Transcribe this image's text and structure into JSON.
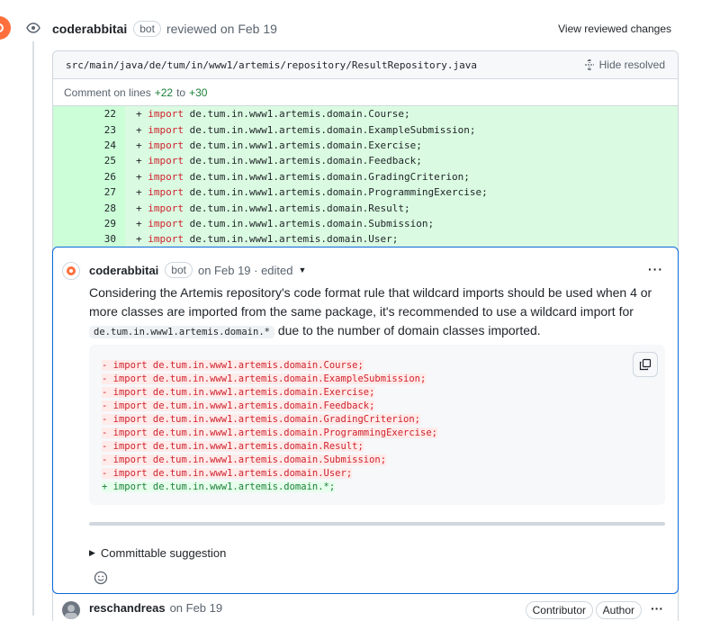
{
  "review": {
    "author": "coderabbitai",
    "badge": "bot",
    "action": "reviewed on Feb 19",
    "view_changes_label": "View reviewed changes"
  },
  "file": {
    "path": "src/main/java/de/tum/in/www1/artemis/repository/ResultRepository.java",
    "hide_resolved_label": "Hide resolved",
    "comment_on_prefix": "Comment on lines",
    "line_start": "+22",
    "line_to": "to",
    "line_end": "+30",
    "diff_lines": [
      {
        "num": "22",
        "sign": "+",
        "kw": "import",
        "rest": " de.tum.in.www1.artemis.domain.Course;"
      },
      {
        "num": "23",
        "sign": "+",
        "kw": "import",
        "rest": " de.tum.in.www1.artemis.domain.ExampleSubmission;"
      },
      {
        "num": "24",
        "sign": "+",
        "kw": "import",
        "rest": " de.tum.in.www1.artemis.domain.Exercise;"
      },
      {
        "num": "25",
        "sign": "+",
        "kw": "import",
        "rest": " de.tum.in.www1.artemis.domain.Feedback;"
      },
      {
        "num": "26",
        "sign": "+",
        "kw": "import",
        "rest": " de.tum.in.www1.artemis.domain.GradingCriterion;"
      },
      {
        "num": "27",
        "sign": "+",
        "kw": "import",
        "rest": " de.tum.in.www1.artemis.domain.ProgrammingExercise;"
      },
      {
        "num": "28",
        "sign": "+",
        "kw": "import",
        "rest": " de.tum.in.www1.artemis.domain.Result;"
      },
      {
        "num": "29",
        "sign": "+",
        "kw": "import",
        "rest": " de.tum.in.www1.artemis.domain.Submission;"
      },
      {
        "num": "30",
        "sign": "+",
        "kw": "import",
        "rest": " de.tum.in.www1.artemis.domain.User;"
      }
    ]
  },
  "comment": {
    "author": "coderabbitai",
    "badge": "bot",
    "meta": "on Feb 19 · edited",
    "more_icon": "kebab-horizontal",
    "body_part1": "Considering the Artemis repository's code format rule that wildcard imports should be used when 4 or more classes are imported from the same package, it's recommended to use a wildcard import for",
    "body_code": "de.tum.in.www1.artemis.domain.*",
    "body_part2": "due to the number of domain classes imported.",
    "suggestion_lines": [
      {
        "type": "del",
        "text": "- import de.tum.in.www1.artemis.domain.Course;"
      },
      {
        "type": "del",
        "text": "- import de.tum.in.www1.artemis.domain.ExampleSubmission;"
      },
      {
        "type": "del",
        "text": "- import de.tum.in.www1.artemis.domain.Exercise;"
      },
      {
        "type": "del",
        "text": "- import de.tum.in.www1.artemis.domain.Feedback;"
      },
      {
        "type": "del",
        "text": "- import de.tum.in.www1.artemis.domain.GradingCriterion;"
      },
      {
        "type": "del",
        "text": "- import de.tum.in.www1.artemis.domain.ProgrammingExercise;"
      },
      {
        "type": "del",
        "text": "- import de.tum.in.www1.artemis.domain.Result;"
      },
      {
        "type": "del",
        "text": "- import de.tum.in.www1.artemis.domain.Submission;"
      },
      {
        "type": "del",
        "text": "- import de.tum.in.www1.artemis.domain.User;"
      },
      {
        "type": "add",
        "text": "+ import de.tum.in.www1.artemis.domain.*;"
      }
    ],
    "committable_label": "Committable suggestion"
  },
  "next_comment": {
    "author": "reschandreas",
    "meta": "on Feb 19",
    "role_contributor": "Contributor",
    "role_author": "Author"
  },
  "colors": {
    "accent": "#0969da",
    "diff_add_bg": "#dafbe1",
    "del_text": "#cf222e",
    "add_text": "#1a7f37",
    "coderabbit_brand": "#ff6f3c"
  }
}
